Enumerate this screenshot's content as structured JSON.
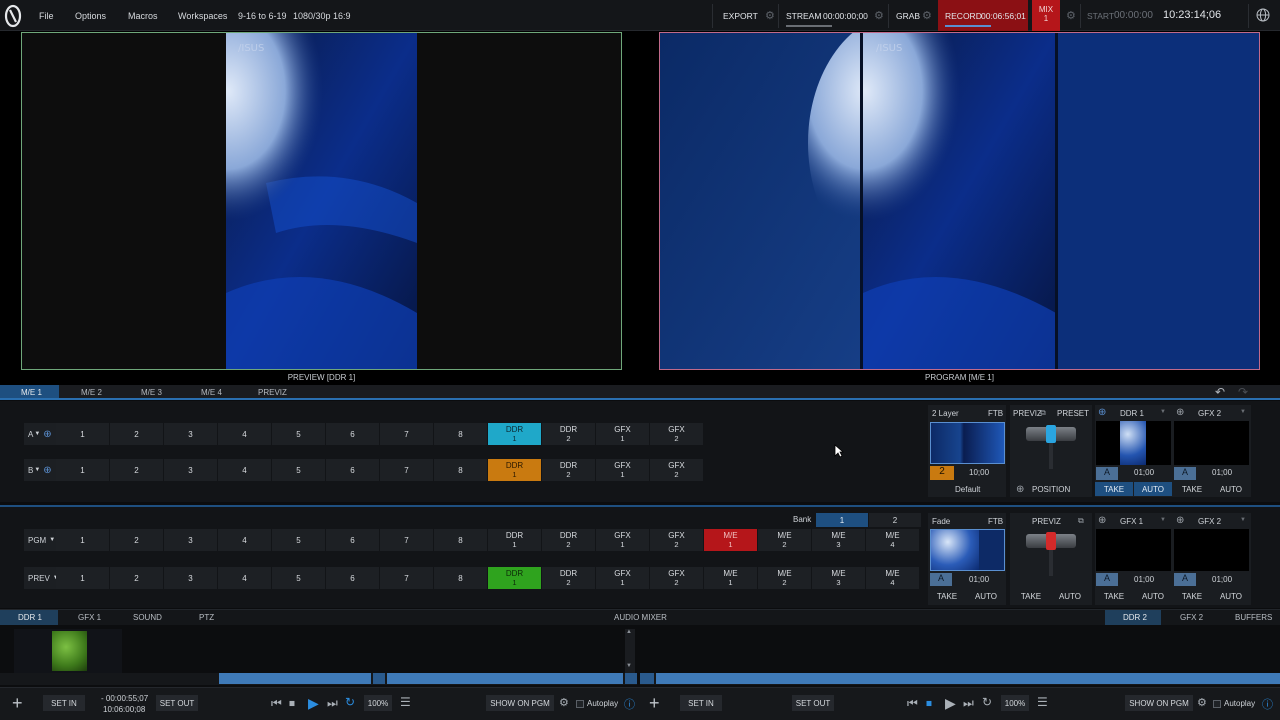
{
  "menu": {
    "items": [
      "File",
      "Options",
      "Macros",
      "Workspaces"
    ],
    "session": "9-16 to 6-19",
    "format": "1080/30p 16:9"
  },
  "status": {
    "export_label": "EXPORT",
    "stream_label": "STREAM",
    "stream_time": "00:00:00;00",
    "grab_label": "GRAB",
    "record_label": "RECORD",
    "record_time": "00:06:56;01",
    "mix_label": "MIX",
    "mix_number": "1",
    "start_label": "START",
    "start_time": "00:00:00",
    "clock": "10:23:14;06",
    "record_color": "#8b1014"
  },
  "monitors": {
    "preview_label": "PREVIEW [DDR 1]",
    "program_label": "PROGRAM [M/E 1]",
    "preview_border": "#6fa77a",
    "program_border": "#c16a8a"
  },
  "me_tabs": [
    "M/E 1",
    "M/E 2",
    "M/E 3",
    "M/E 4",
    "PREVIZ"
  ],
  "me_buses": {
    "a_label": "A",
    "b_label": "B",
    "numbers": [
      "1",
      "2",
      "3",
      "4",
      "5",
      "6",
      "7",
      "8"
    ],
    "sources": [
      {
        "top": "DDR",
        "sub": "1"
      },
      {
        "top": "DDR",
        "sub": "2"
      },
      {
        "top": "GFX",
        "sub": "1"
      },
      {
        "top": "GFX",
        "sub": "2"
      }
    ]
  },
  "me_panel": {
    "layer_label": "2 Layer",
    "ftb_label": "FTB",
    "previz_label": "PREVIZ",
    "preset_label": "PRESET",
    "ddr1_label": "DDR 1",
    "gfx2_label": "GFX 2",
    "layer_badge": "2",
    "duration": "10;00",
    "default_label": "Default",
    "position_label": "POSITION",
    "dsk_time_a": "01;00",
    "dsk_time_b": "01;00",
    "take": "TAKE",
    "auto": "AUTO"
  },
  "switcher": {
    "bank_label": "Bank",
    "banks": [
      "1",
      "2"
    ],
    "pgm_label": "PGM",
    "prev_label": "PREV",
    "numbers": [
      "1",
      "2",
      "3",
      "4",
      "5",
      "6",
      "7",
      "8"
    ],
    "sources": [
      {
        "top": "DDR",
        "sub": "1"
      },
      {
        "top": "DDR",
        "sub": "2"
      },
      {
        "top": "GFX",
        "sub": "1"
      },
      {
        "top": "GFX",
        "sub": "2"
      },
      {
        "top": "M/E",
        "sub": "1"
      },
      {
        "top": "M/E",
        "sub": "2"
      },
      {
        "top": "M/E",
        "sub": "3"
      },
      {
        "top": "M/E",
        "sub": "4"
      }
    ],
    "fade_label": "Fade",
    "ftb_label": "FTB",
    "previz_label": "PREVIZ",
    "gfx1_label": "GFX 1",
    "gfx2_label": "GFX 2",
    "time_a": "01;00",
    "time_b": "01;00",
    "time_c": "01;00",
    "take": "TAKE",
    "auto": "AUTO"
  },
  "bottom_tabs": {
    "left": [
      "DDR 1",
      "GFX 1",
      "SOUND",
      "PTZ"
    ],
    "center": "AUDIO MIXER",
    "right": [
      "DDR 2",
      "GFX 2",
      "BUFFERS"
    ]
  },
  "transport": {
    "set_in": "SET IN",
    "set_out": "SET OUT",
    "remaining": "- 00:00:55;07",
    "position": "10:06:00;08",
    "zoom": "100%",
    "show_on_pgm": "SHOW ON PGM",
    "autoplay": "Autoplay"
  }
}
